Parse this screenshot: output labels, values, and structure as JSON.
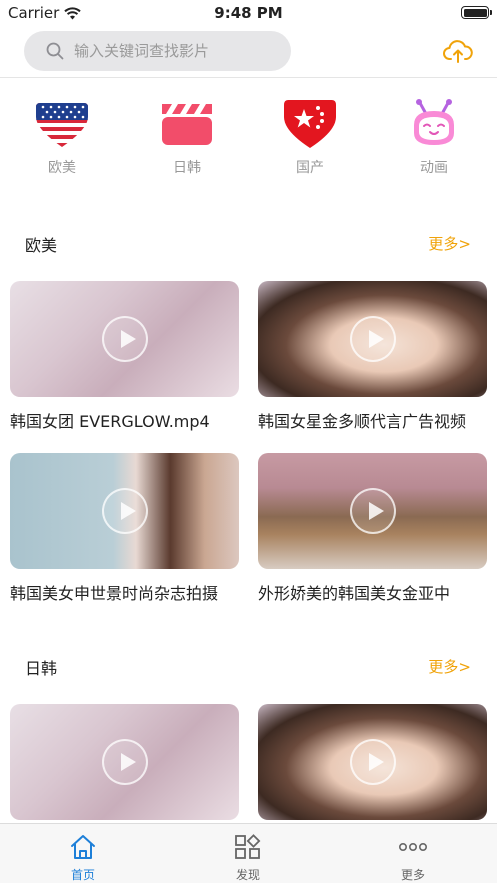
{
  "status": {
    "carrier": "Carrier",
    "time": "9:48 PM"
  },
  "search": {
    "placeholder": "输入关键词查找影片"
  },
  "categories": [
    {
      "label": "欧美",
      "icon": "us-flag-icon"
    },
    {
      "label": "日韩",
      "icon": "clapperboard-icon"
    },
    {
      "label": "国产",
      "icon": "china-flag-icon"
    },
    {
      "label": "动画",
      "icon": "cartoon-face-icon"
    }
  ],
  "sections": [
    {
      "title": "欧美",
      "more": "更多>",
      "videos": [
        {
          "title": "韩国女团 EVERGLOW.mp4"
        },
        {
          "title": "韩国女星金多顺代言广告视频"
        },
        {
          "title": "韩国美女申世景时尚杂志拍摄"
        },
        {
          "title": "外形娇美的韩国美女金亚中"
        }
      ]
    },
    {
      "title": "日韩",
      "more": "更多>",
      "videos": [
        {
          "title": ""
        },
        {
          "title": ""
        }
      ]
    }
  ],
  "tabs": [
    {
      "label": "首页",
      "icon": "home-icon",
      "active": true
    },
    {
      "label": "发现",
      "icon": "discover-grid-icon",
      "active": false
    },
    {
      "label": "更多",
      "icon": "more-dots-icon",
      "active": false
    }
  ],
  "colors": {
    "accent": "#f0a30a",
    "tab_active": "#1d7fd8",
    "muted": "#999999"
  }
}
